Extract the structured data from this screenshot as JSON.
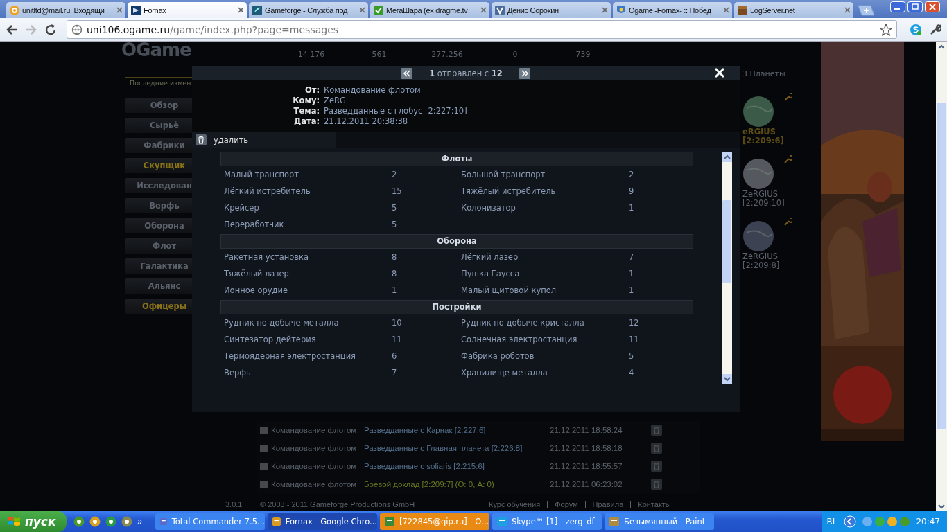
{
  "browser": {
    "tabs": [
      {
        "title": "unitltd@mail.ru: Входящи",
        "selected": false
      },
      {
        "title": "Fornax",
        "selected": true
      },
      {
        "title": "Gameforge - Служба под",
        "selected": false
      },
      {
        "title": "МегаШара (ex dragme.tv",
        "selected": false
      },
      {
        "title": "Денис Сорокин",
        "selected": false
      },
      {
        "title": "Ogame -Fornax- :: Побед",
        "selected": false
      },
      {
        "title": "LogServer.net",
        "selected": false
      }
    ],
    "address": {
      "host": "uni106.ogame.ru",
      "path": "/game/index.php?page=messages"
    }
  },
  "game": {
    "logo": "OGame",
    "news_box": "Последние измен",
    "resources": [
      "14.176",
      "561",
      "277.256",
      "0",
      "739"
    ],
    "menu": [
      {
        "label": "Обзор",
        "highlighted": false
      },
      {
        "label": "Сырьё",
        "highlighted": false
      },
      {
        "label": "Фабрики",
        "highlighted": false
      },
      {
        "label": "Скупщик",
        "highlighted": true
      },
      {
        "label": "Исследован",
        "highlighted": false
      },
      {
        "label": "Верфь",
        "highlighted": false
      },
      {
        "label": "Оборона",
        "highlighted": false
      },
      {
        "label": "Флот",
        "highlighted": false
      },
      {
        "label": "Галактика",
        "highlighted": false
      },
      {
        "label": "Альянс",
        "highlighted": false
      },
      {
        "label": "Офицеры",
        "highlighted": true
      }
    ],
    "planets_header": "3 Планеты",
    "planets": [
      {
        "name": "eRGIUS",
        "coords": "[2:209:6]",
        "selected": true,
        "color": "#3c5a48"
      },
      {
        "name": "ZeRGIUS",
        "coords": "[2:209:10]",
        "selected": false,
        "color": "#55585e"
      },
      {
        "name": "ZeRGIUS",
        "coords": "[2:209:8]",
        "selected": false,
        "color": "#3d4252"
      }
    ],
    "ad": {
      "kind": "picture"
    },
    "messages": [
      {
        "checked": false,
        "sender": "Командование флотом",
        "subject": "Разведданные с Карнак [2:227:6]",
        "date": "21.12.2011 18:58:24",
        "kind": "espionage"
      },
      {
        "checked": false,
        "sender": "Командование флотом",
        "subject": "Разведданные с Главная планета [2:226:8]",
        "date": "21.12.2011 18:58:18",
        "kind": "espionage"
      },
      {
        "checked": false,
        "sender": "Командование флотом",
        "subject": "Разведданные с soliaris [2:215:6]",
        "date": "21.12.2011 18:55:57",
        "kind": "espionage"
      },
      {
        "checked": false,
        "sender": "Командование флотом",
        "subject": "Боевой доклад [2:209:7] (О: 0, А: 0)",
        "date": "21.12.2011 06:23:02",
        "kind": "combat"
      }
    ],
    "footer": {
      "version": "3.0.1",
      "copyright": "© 2003 - 2011 Gameforge Productions GmbH",
      "links": [
        "Курс обучения",
        "Форум",
        "Правила",
        "Контакты"
      ]
    }
  },
  "dialog": {
    "pager": "**1** отправлен с **12**",
    "fields": [
      {
        "label": "От:",
        "value": "Командование флотом"
      },
      {
        "label": "Кому:",
        "value": "ZeRG"
      },
      {
        "label": "Тема:",
        "value": "Разведданные с глобус [2:227:10]"
      },
      {
        "label": "Дата:",
        "value": "21.12.2011 20:38:38"
      }
    ],
    "delete_button": "удалить",
    "sections": [
      {
        "title": "Флоты",
        "items": [
          {
            "name": "Малый транспорт",
            "value": "2"
          },
          {
            "name": "Большой транспорт",
            "value": "2"
          },
          {
            "name": "Лёгкий истребитель",
            "value": "15"
          },
          {
            "name": "Тяжёлый истребитель",
            "value": "9"
          },
          {
            "name": "Крейсер",
            "value": "5"
          },
          {
            "name": "Колонизатор",
            "value": "1"
          },
          {
            "name": "Переработчик",
            "value": "5"
          }
        ]
      },
      {
        "title": "Оборона",
        "items": [
          {
            "name": "Ракетная установка",
            "value": "8"
          },
          {
            "name": "Лёгкий лазер",
            "value": "7"
          },
          {
            "name": "Тяжёлый лазер",
            "value": "8"
          },
          {
            "name": "Пушка Гаусса",
            "value": "1"
          },
          {
            "name": "Ионное орудие",
            "value": "1"
          },
          {
            "name": "Малый щитовой купол",
            "value": "1"
          }
        ]
      },
      {
        "title": "Постройки",
        "items": [
          {
            "name": "Рудник по добыче металла",
            "value": "10"
          },
          {
            "name": "Рудник по добыче кристалла",
            "value": "12"
          },
          {
            "name": "Синтезатор дейтерия",
            "value": "11"
          },
          {
            "name": "Солнечная электростанция",
            "value": "11"
          },
          {
            "name": "Термоядерная электростанция",
            "value": "6"
          },
          {
            "name": "Фабрика роботов",
            "value": "5"
          },
          {
            "name": "Верфь",
            "value": "7"
          },
          {
            "name": "Хранилище металла",
            "value": "4"
          }
        ]
      }
    ]
  },
  "taskbar": {
    "start": "пуск",
    "tasks": [
      {
        "title": "Total Commander 7.5...",
        "selected": false,
        "flashing": false
      },
      {
        "title": "Fornax - Google Chro...",
        "selected": true,
        "flashing": false
      },
      {
        "title": "[722845@qip.ru] - О...",
        "selected": false,
        "flashing": true
      },
      {
        "title": "Skype™ [1] - zerg_df",
        "selected": false,
        "flashing": false
      },
      {
        "title": "Безымянный - Paint",
        "selected": false,
        "flashing": false
      }
    ],
    "language": "RL",
    "clock": "20:47"
  }
}
